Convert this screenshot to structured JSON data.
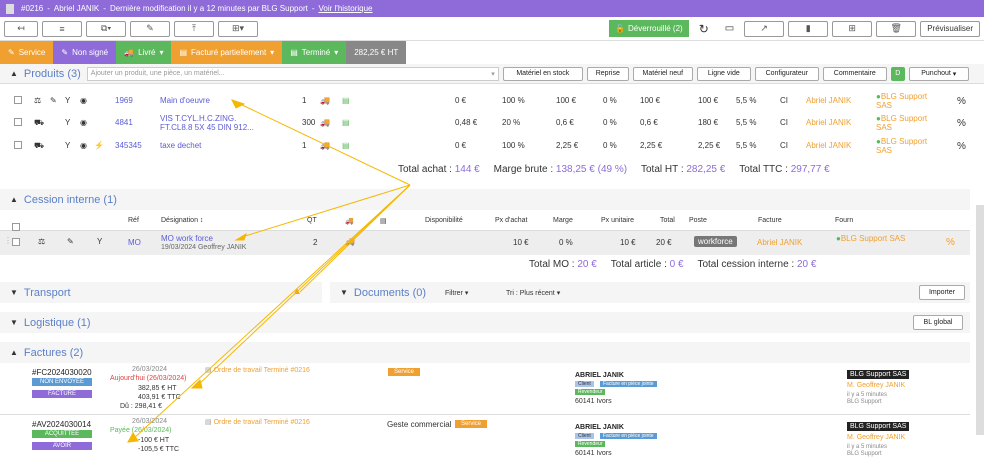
{
  "topbar": {
    "ref": "#0216",
    "sep": "-",
    "user": "Abriel JANIK",
    "modified": "Dernière modification il y a 12 minutes par BLG Support",
    "history_link": "Voir l'historique"
  },
  "toolbar": {
    "lock_label": "Déverrouillé (2)",
    "preview_label": "Prévisualiser"
  },
  "status": {
    "steps": [
      {
        "label": "Service",
        "color": "#f0a030"
      },
      {
        "label": "Non signé",
        "color": "#8e6bd9"
      },
      {
        "label": "Livré",
        "color": "#5cb85c"
      },
      {
        "label": "Facturé partiellement",
        "color": "#f0a030"
      },
      {
        "label": "Terminé",
        "color": "#5cb85c"
      }
    ],
    "amount": "282,25 € HT"
  },
  "products": {
    "title": "Produits (3)",
    "add_placeholder": "Ajouter un produit, une pièce, un matériel...",
    "columns": [
      "Matériel en stock",
      "Reprise",
      "Matériel neuf",
      "Ligne vide",
      "Configurateur",
      "Commentaire",
      "D",
      "Punchout"
    ],
    "rows": [
      {
        "code": "1969",
        "name": "Main d'oeuvre",
        "qty": "1",
        "pa": "0 €",
        "marge": "100 %",
        "pu": "100 €",
        "remise": "0 %",
        "net": "100 €",
        "total": "100 €",
        "tva": "5,5 %",
        "type": "CI",
        "user": "Abriel JANIK",
        "supplier": "BLG Support SAS",
        "pct": "%"
      },
      {
        "code": "4841",
        "name": "VIS T.CYL.H.C.ZING. FT.CL8.8 5X 45 DIN 912...",
        "qty": "300",
        "pa": "0,48 €",
        "marge": "20 %",
        "pu": "0,6 €",
        "remise": "0 %",
        "net": "0,6 €",
        "total": "180 €",
        "tva": "5,5 %",
        "type": "CI",
        "user": "Abriel JANIK",
        "supplier": "BLG Support SAS",
        "pct": "%"
      },
      {
        "code": "345345",
        "name": "taxe dechet",
        "qty": "1",
        "pa": "0 €",
        "marge": "100 %",
        "pu": "2,25 €",
        "remise": "0 %",
        "net": "2,25 €",
        "total": "2,25 €",
        "tva": "5,5 %",
        "type": "CI",
        "user": "Abriel JANIK",
        "supplier": "BLG Support SAS",
        "pct": "%"
      }
    ],
    "totals": {
      "achat_label": "Total achat :",
      "achat": "144 €",
      "marge_label": "Marge brute :",
      "marge": "138,25 € (49 %)",
      "ht_label": "Total HT :",
      "ht": "282,25 €",
      "ttc_label": "Total TTC :",
      "ttc": "297,77 €"
    }
  },
  "cession": {
    "title": "Cession interne (1)",
    "headers": [
      "Réf",
      "Désignation ↕",
      "QT",
      "Disponibilité",
      "Px d'achat",
      "Marge",
      "Px unitaire",
      "Total",
      "Poste",
      "Facture",
      "Fourn"
    ],
    "row": {
      "ref": "MO",
      "name": "MO work force",
      "sub": "19/03/2024 Geoffrey JANIK",
      "qty": "2",
      "pa": "10 €",
      "marge": "0 %",
      "pu": "10 €",
      "total": "20 €",
      "poste": "workforce",
      "facture": "Abriel JANIK",
      "fourn": "BLG Support SAS",
      "pct": "%"
    },
    "totals": {
      "mo_label": "Total MO :",
      "mo": "20 €",
      "article_label": "Total article :",
      "article": "0 €",
      "cession_label": "Total cession interne :",
      "cession": "20 €"
    }
  },
  "transport": {
    "title": "Transport"
  },
  "documents": {
    "title": "Documents (0)",
    "filter": "Filtrer",
    "sort": "Tri : Plus récent",
    "import": "Importer"
  },
  "logistique": {
    "title": "Logistique (1)",
    "bl": "BL global"
  },
  "factures": {
    "title": "Factures (2)",
    "items": [
      {
        "num": "#FC2024030020",
        "status": "NON ENVOYÉE",
        "status_color": "#5b9bd5",
        "kind": "FACTURE",
        "kind_color": "#8e6bd9",
        "date": "26/03/2024",
        "due": "Aujourd'hui (26/03/2024)",
        "due_color": "#e04040",
        "ht": "382,85 €",
        "ht_label": "HT",
        "ttc": "403,91 €",
        "ttc_label": "TTC",
        "du": "Dû : 298,41 €",
        "ordre": "Ordre de travail Terminé #0216",
        "tag": "Service",
        "client": "ABRIEL JANIK",
        "client_tag1": "Client",
        "client_tag2": "Facture en pièce jointe",
        "client_tag3": "Revendeur",
        "city": "60141 Ivors",
        "company": "BLG Support SAS",
        "contact": "M. Geoffrey JANIK",
        "time": "il y a 5 minutes",
        "by": "BLG Support"
      },
      {
        "num": "#AV2024030014",
        "status": "ACQUITTÉE",
        "status_color": "#5cb85c",
        "kind": "AVOIR",
        "kind_color": "#8e6bd9",
        "date": "26/03/2024",
        "due": "Payée (26/03/2024)",
        "due_color": "#5cb85c",
        "ht": "-100 €",
        "ht_label": "HT",
        "ttc": "-105,5 €",
        "ttc_label": "TTC",
        "du": "",
        "ordre": "Ordre de travail Terminé #0216",
        "geste": "Geste commercial",
        "tag": "Service",
        "client": "ABRIEL JANIK",
        "client_tag1": "Client",
        "client_tag2": "Facture en pièce jointe",
        "client_tag3": "Revendeur",
        "city": "60141 Ivors",
        "company": "BLG Support SAS",
        "contact": "M. Geoffrey JANIK",
        "time": "il y a 5 minutes",
        "by": "BLG Support"
      }
    ]
  }
}
